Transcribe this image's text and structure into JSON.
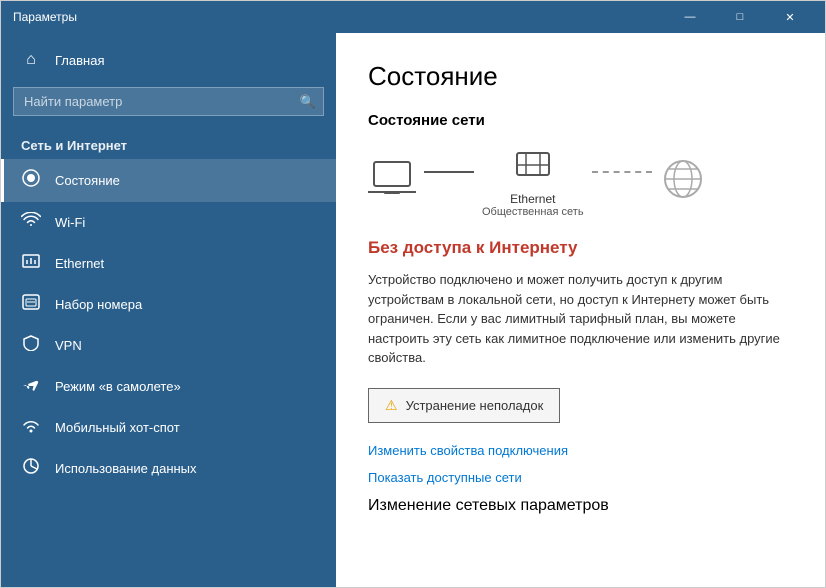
{
  "window": {
    "title": "Параметры",
    "min_btn": "—",
    "max_btn": "□",
    "close_btn": "✕"
  },
  "sidebar": {
    "home_label": "Главная",
    "search_placeholder": "Найти параметр",
    "section_label": "Сеть и Интернет",
    "items": [
      {
        "id": "status",
        "label": "Состояние",
        "icon": "⊕",
        "active": true
      },
      {
        "id": "wifi",
        "label": "Wi-Fi",
        "icon": "((·))"
      },
      {
        "id": "ethernet",
        "label": "Ethernet",
        "icon": "⊟"
      },
      {
        "id": "dialup",
        "label": "Набор номера",
        "icon": "⊡"
      },
      {
        "id": "vpn",
        "label": "VPN",
        "icon": "⊛"
      },
      {
        "id": "airplane",
        "label": "Режим «в самолете»",
        "icon": "✈"
      },
      {
        "id": "hotspot",
        "label": "Мобильный хот-спот",
        "icon": "((·))"
      },
      {
        "id": "datausage",
        "label": "Использование данных",
        "icon": "◉"
      }
    ]
  },
  "main": {
    "title": "Состояние",
    "network_status_label": "Состояние сети",
    "device_label": "Ethernet",
    "device_sublabel": "Общественная сеть",
    "error_title": "Без доступа к Интернету",
    "error_desc": "Устройство подключено и может получить доступ к другим устройствам в локальной сети, но доступ к Интернету может быть ограничен. Если у вас лимитный тарифный план, вы можете настроить эту сеть как лимитное подключение или изменить другие свойства.",
    "troubleshoot_label": "Устранение неполадок",
    "link1": "Изменить свойства подключения",
    "link2": "Показать доступные сети",
    "section2_title": "Изменение сетевых параметров"
  },
  "icons": {
    "home": "⌂",
    "search": "🔍",
    "status": "●",
    "wifi": "wifi",
    "ethernet": "ethernet",
    "dialup": "📞",
    "vpn": "vpn",
    "airplane": "✈",
    "hotspot": "hotspot",
    "datausage": "chart"
  }
}
